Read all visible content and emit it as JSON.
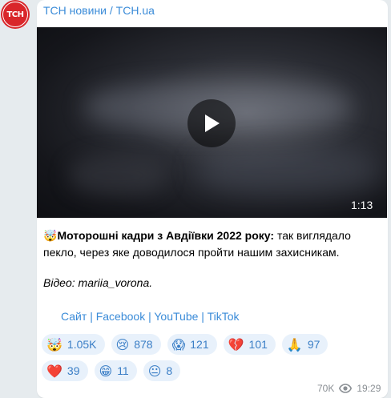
{
  "channel": {
    "avatar_text": "ТСН",
    "name": "ТСН новини / TCH.ua"
  },
  "video": {
    "duration": "1:13"
  },
  "post": {
    "emoji": "🤯",
    "headline": "Моторошні кадри з Авдіївки 2022 року:",
    "body": " так виглядало пекло, через яке доводилося пройти нашим захисникам.",
    "credit": "Відео: mariia_vorona."
  },
  "links": [
    {
      "label": "Сайт"
    },
    {
      "label": "Facebook"
    },
    {
      "label": "YouTube"
    },
    {
      "label": "TikTok"
    }
  ],
  "link_separator": "|",
  "reactions": [
    {
      "emoji": "🤯",
      "count": "1.05K"
    },
    {
      "emoji": "😢",
      "count": "878"
    },
    {
      "emoji": "😱",
      "count": "121"
    },
    {
      "emoji": "💔",
      "count": "101"
    },
    {
      "emoji": "🙏",
      "count": "97"
    },
    {
      "emoji": "❤️",
      "count": "39"
    },
    {
      "emoji": "😁",
      "count": "11"
    },
    {
      "emoji": "😐",
      "count": "8"
    }
  ],
  "meta": {
    "views": "70K",
    "time": "19:29"
  }
}
